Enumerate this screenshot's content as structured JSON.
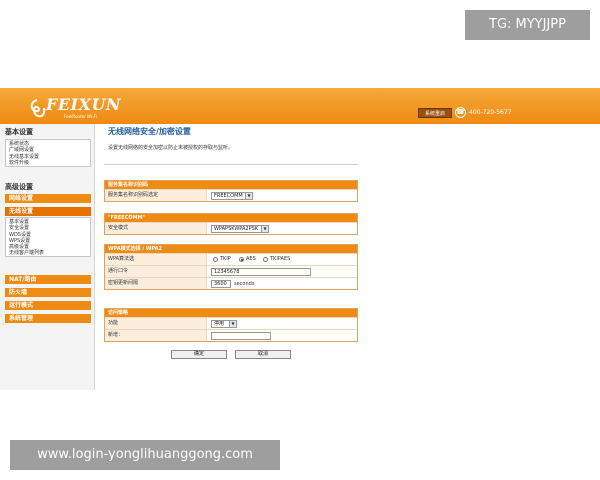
{
  "watermark_top": "TG: MYYJJPP",
  "watermark_bottom": "www.login-yonglihuanggong.com",
  "header": {
    "brand": "FEIXUN",
    "brand_sub": "FeelRouter Wi-Fi",
    "system_button": "系统重启",
    "phone": "400-720-5677"
  },
  "sidebar": {
    "basic_title": "基本设置",
    "basic_items": [
      "系统状态",
      "广域网设置",
      "无线基本设置",
      "软件升级"
    ],
    "advanced_title": "高级设置",
    "menus": [
      {
        "label": "网络设置",
        "active": false
      },
      {
        "label": "无线设置",
        "active": true
      }
    ],
    "wireless_items": [
      "基本设置",
      "安全设置",
      "WDS设置",
      "WPS设置",
      "高级设置",
      "无线客户端列表"
    ],
    "menus2": [
      "NAT/路由",
      "防火墙",
      "运行模式",
      "系统管理"
    ]
  },
  "main": {
    "title": "无线网络安全/加密设置",
    "description": "设置无线网络的安全加密以防止未被授权的存取与监听。",
    "ssid_panel": {
      "header": "服务集名称识别码",
      "label": "服务集名称识别码选定",
      "value": "FREECOMM"
    },
    "mode_panel": {
      "header": "\"FREECOMM\"",
      "label": "安全模式",
      "value": "WPAPSKWPA2PSK"
    },
    "wpa_panel": {
      "header": "WPA模式选择 / WPA2",
      "cipher_label": "WPA算法选",
      "cipher_options": [
        "TKIP",
        "AES",
        "TKIPAES"
      ],
      "cipher_selected": "AES",
      "key_label": "通行口令",
      "key_value": "12345678",
      "interval_label": "密钥更新间隔",
      "interval_value": "3600",
      "interval_unit": "seconds"
    },
    "access_panel": {
      "header": "访问策略",
      "policy_label": "功能",
      "policy_value": "停用",
      "add_label": "新增："
    },
    "ok_button": "确定",
    "cancel_button": "取消"
  }
}
